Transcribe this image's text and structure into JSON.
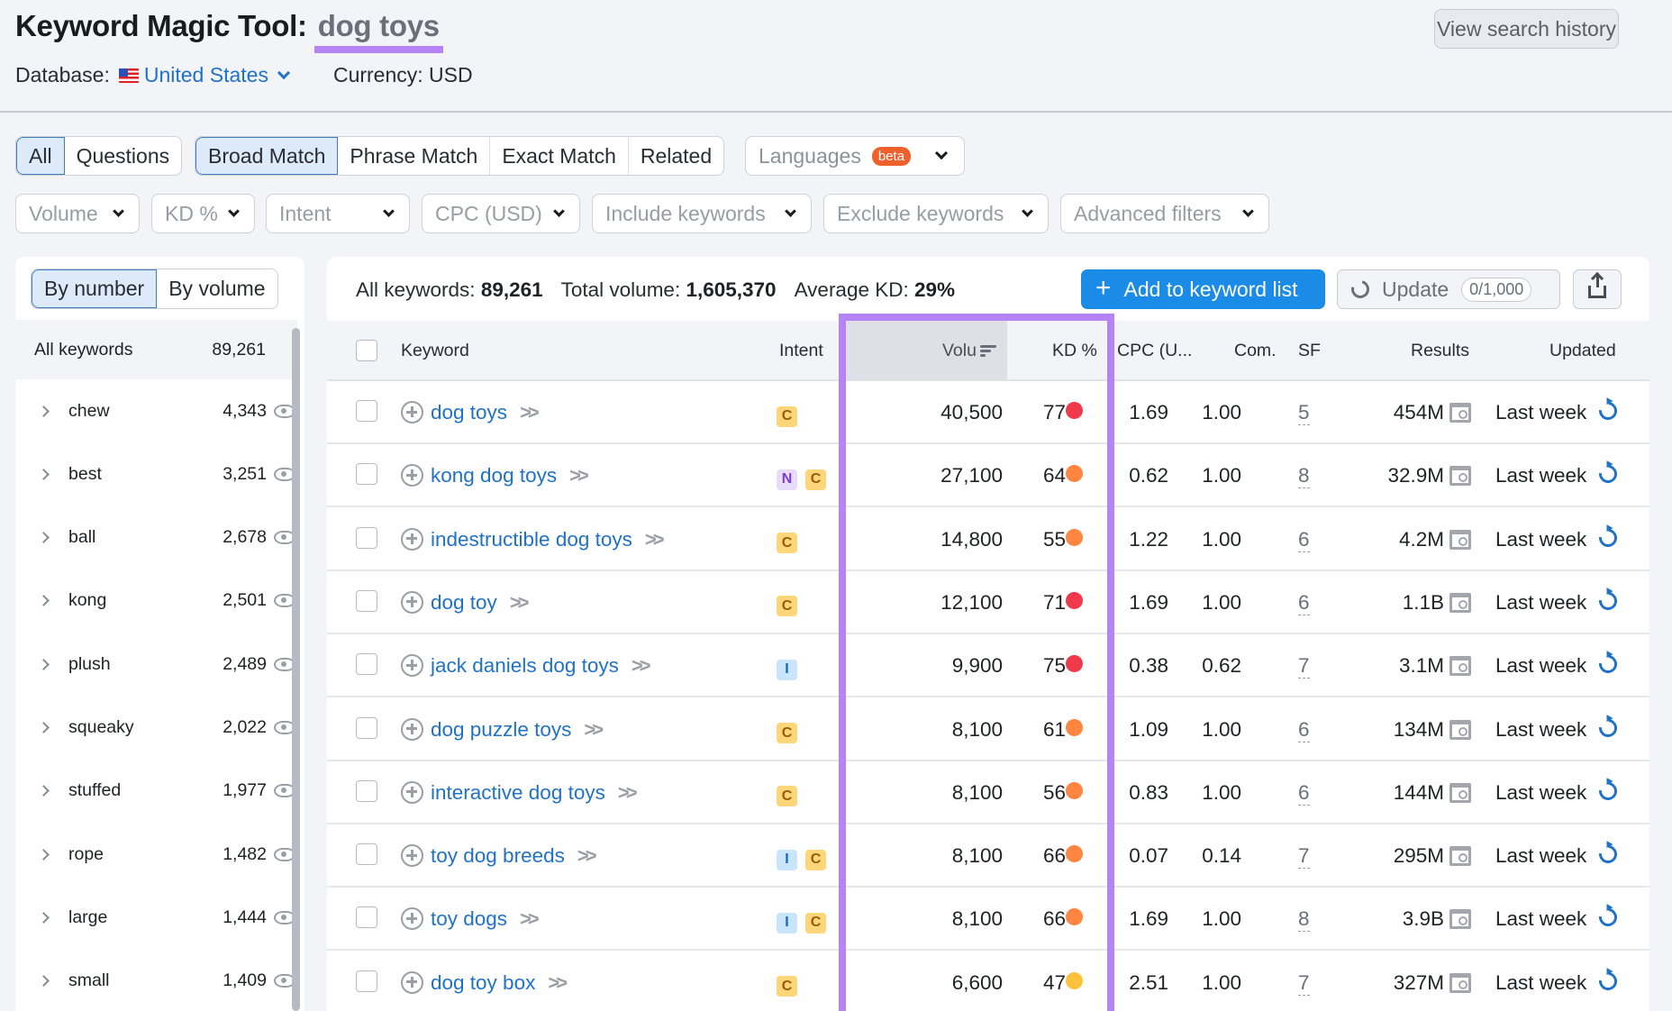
{
  "header": {
    "title": "Keyword Magic Tool:",
    "query": "dog toys",
    "database_label": "Database:",
    "database_value": "United States",
    "currency": "Currency: USD",
    "history_button": "View search history"
  },
  "tabs": {
    "group1": [
      {
        "label": "All",
        "active": true
      },
      {
        "label": "Questions",
        "active": false
      }
    ],
    "group2": [
      {
        "label": "Broad Match",
        "active": true
      },
      {
        "label": "Phrase Match",
        "active": false
      },
      {
        "label": "Exact Match",
        "active": false
      },
      {
        "label": "Related",
        "active": false
      }
    ],
    "languages": {
      "label": "Languages",
      "badge": "beta"
    }
  },
  "filters": [
    "Volume",
    "KD %",
    "Intent",
    "CPC (USD)",
    "Include keywords",
    "Exclude keywords",
    "Advanced filters"
  ],
  "sidebar": {
    "toggle": [
      {
        "label": "By number",
        "active": true
      },
      {
        "label": "By volume",
        "active": false
      }
    ],
    "all": {
      "label": "All keywords",
      "count": "89,261"
    },
    "groups": [
      {
        "label": "chew",
        "count": "4,343"
      },
      {
        "label": "best",
        "count": "3,251"
      },
      {
        "label": "ball",
        "count": "2,678"
      },
      {
        "label": "kong",
        "count": "2,501"
      },
      {
        "label": "plush",
        "count": "2,489"
      },
      {
        "label": "squeaky",
        "count": "2,022"
      },
      {
        "label": "stuffed",
        "count": "1,977"
      },
      {
        "label": "rope",
        "count": "1,482"
      },
      {
        "label": "large",
        "count": "1,444"
      },
      {
        "label": "small",
        "count": "1,409"
      }
    ]
  },
  "summary": {
    "all_label": "All keywords:",
    "all_value": "89,261",
    "volume_label": "Total volume:",
    "volume_value": "1,605,370",
    "kd_label": "Average KD:",
    "kd_value": "29%"
  },
  "actions": {
    "add": "Add to keyword list",
    "update": "Update",
    "quota": "0/1,000"
  },
  "table": {
    "columns": {
      "keyword": "Keyword",
      "intent": "Intent",
      "volume": "Volu",
      "kd": "KD %",
      "cpc": "CPC (U...",
      "com": "Com.",
      "sf": "SF",
      "results": "Results",
      "updated": "Updated"
    },
    "kd_colors": {
      "hard": "#f03a4c",
      "difficult": "#ff8540",
      "possible": "#fdc23c"
    },
    "rows": [
      {
        "keyword": "dog toys",
        "intent": [
          "C"
        ],
        "volume": "40,500",
        "kd": "77",
        "kd_level": "hard",
        "cpc": "1.69",
        "com": "1.00",
        "sf": "5",
        "results": "454M",
        "updated": "Last week"
      },
      {
        "keyword": "kong dog toys",
        "intent": [
          "N",
          "C"
        ],
        "volume": "27,100",
        "kd": "64",
        "kd_level": "difficult",
        "cpc": "0.62",
        "com": "1.00",
        "sf": "8",
        "results": "32.9M",
        "updated": "Last week"
      },
      {
        "keyword": "indestructible dog toys",
        "intent": [
          "C"
        ],
        "volume": "14,800",
        "kd": "55",
        "kd_level": "difficult",
        "cpc": "1.22",
        "com": "1.00",
        "sf": "6",
        "results": "4.2M",
        "updated": "Last week"
      },
      {
        "keyword": "dog toy",
        "intent": [
          "C"
        ],
        "volume": "12,100",
        "kd": "71",
        "kd_level": "hard",
        "cpc": "1.69",
        "com": "1.00",
        "sf": "6",
        "results": "1.1B",
        "updated": "Last week"
      },
      {
        "keyword": "jack daniels dog toys",
        "intent": [
          "I"
        ],
        "volume": "9,900",
        "kd": "75",
        "kd_level": "hard",
        "cpc": "0.38",
        "com": "0.62",
        "sf": "7",
        "results": "3.1M",
        "updated": "Last week"
      },
      {
        "keyword": "dog puzzle toys",
        "intent": [
          "C"
        ],
        "volume": "8,100",
        "kd": "61",
        "kd_level": "difficult",
        "cpc": "1.09",
        "com": "1.00",
        "sf": "6",
        "results": "134M",
        "updated": "Last week"
      },
      {
        "keyword": "interactive dog toys",
        "intent": [
          "C"
        ],
        "volume": "8,100",
        "kd": "56",
        "kd_level": "difficult",
        "cpc": "0.83",
        "com": "1.00",
        "sf": "6",
        "results": "144M",
        "updated": "Last week"
      },
      {
        "keyword": "toy dog breeds",
        "intent": [
          "I",
          "C"
        ],
        "volume": "8,100",
        "kd": "66",
        "kd_level": "difficult",
        "cpc": "0.07",
        "com": "0.14",
        "sf": "7",
        "results": "295M",
        "updated": "Last week"
      },
      {
        "keyword": "toy dogs",
        "intent": [
          "I",
          "C"
        ],
        "volume": "8,100",
        "kd": "66",
        "kd_level": "difficult",
        "cpc": "1.69",
        "com": "1.00",
        "sf": "8",
        "results": "3.9B",
        "updated": "Last week"
      },
      {
        "keyword": "dog toy box",
        "intent": [
          "C"
        ],
        "volume": "6,600",
        "kd": "47",
        "kd_level": "possible",
        "cpc": "2.51",
        "com": "1.00",
        "sf": "7",
        "results": "327M",
        "updated": "Last week"
      }
    ]
  }
}
